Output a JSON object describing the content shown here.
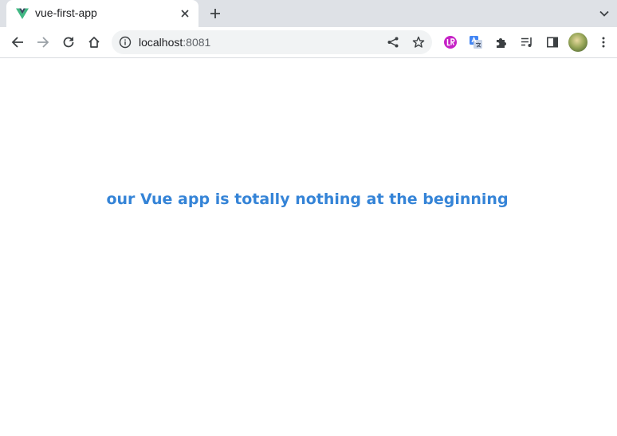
{
  "tab": {
    "title": "vue-first-app",
    "active": true
  },
  "address_bar": {
    "host": "localhost",
    "port": ":8081"
  },
  "page": {
    "heading": "our Vue app is totally nothing at the beginning"
  },
  "colors": {
    "heading": "#3584d7",
    "tabstrip": "#dee1e6",
    "omnibox": "#f1f3f4",
    "vue_logo_outer": "#41b883",
    "vue_logo_inner": "#35495e"
  },
  "icons": {
    "tab": [
      "vue-logo-icon",
      "close-icon"
    ],
    "tabstrip": [
      "plus-icon",
      "chevron-down-icon"
    ],
    "navigation": [
      "back-arrow-icon",
      "forward-arrow-icon",
      "reload-icon",
      "home-icon"
    ],
    "omnibox": [
      "info-icon",
      "share-icon",
      "star-icon"
    ],
    "extensions": [
      "lr-extension-icon",
      "translate-extension-icon",
      "puzzle-icon",
      "media-queue-icon",
      "side-panel-icon",
      "profile-avatar",
      "kebab-menu-icon"
    ]
  }
}
